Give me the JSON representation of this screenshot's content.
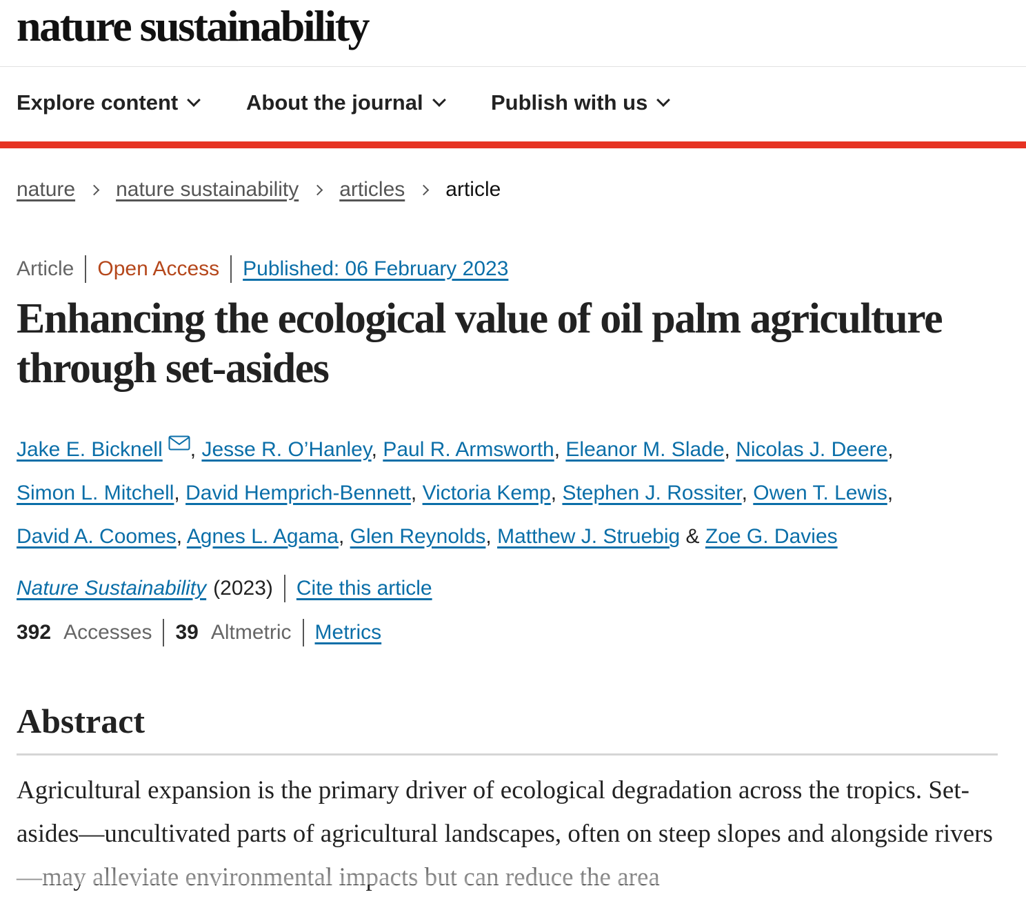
{
  "header": {
    "logo": "nature sustainability"
  },
  "nav": {
    "items": [
      {
        "label": "Explore content"
      },
      {
        "label": "About the journal"
      },
      {
        "label": "Publish with us"
      }
    ],
    "accent_color": "#e63323"
  },
  "breadcrumb": {
    "links": [
      "nature",
      "nature sustainability",
      "articles"
    ],
    "current": "article"
  },
  "article": {
    "type": "Article",
    "access": "Open Access",
    "published": "Published: 06 February 2023",
    "title": "Enhancing the ecological value of oil palm agriculture through set-asides",
    "authors": [
      "Jake E. Bicknell",
      "Jesse R. O’Hanley",
      "Paul R. Armsworth",
      "Eleanor M. Slade",
      "Nicolas J. Deere",
      "Simon L. Mitchell",
      "David Hemprich-Bennett",
      "Victoria Kemp",
      "Stephen J. Rossiter",
      "Owen T. Lewis",
      "David A. Coomes",
      "Agnes L. Agama",
      "Glen Reynolds",
      "Matthew J. Struebig",
      "Zoe G. Davies"
    ],
    "corresponding_icon": "mail-icon",
    "journal": "Nature Sustainability",
    "year": "(2023)",
    "cite_label": "Cite this article",
    "metrics": {
      "accesses_count": "392",
      "accesses_label": "Accesses",
      "altmetric_count": "39",
      "altmetric_label": "Altmetric",
      "metrics_link": "Metrics"
    }
  },
  "abstract": {
    "heading": "Abstract",
    "text": "Agricultural expansion is the primary driver of ecological degradation across the tropics. Set-asides—uncultivated parts of agricultural landscapes, often on steep slopes and alongside rivers—may alleviate environmental impacts but can reduce the area"
  },
  "colors": {
    "link": "#0a6ea8",
    "open_access": "#b5471b",
    "text": "#222222"
  }
}
